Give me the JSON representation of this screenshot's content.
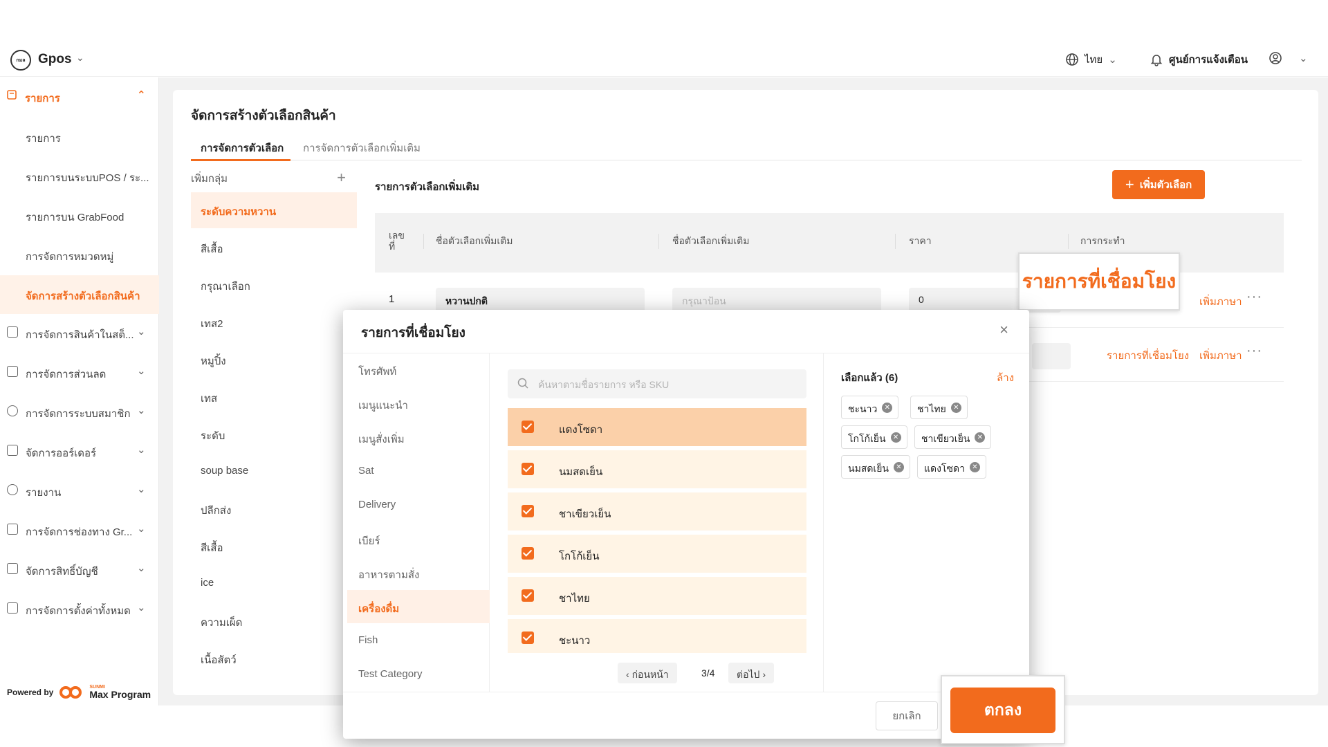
{
  "topbar": {
    "brand": "Gpos",
    "logo_text": "กมล",
    "language": "ไทย",
    "notifications": "ศูนย์การแจ้งเตือน"
  },
  "sidebar": {
    "section": "รายการ",
    "items": [
      {
        "label": "รายการ"
      },
      {
        "label": "รายการบนระบบPOS / ระ..."
      },
      {
        "label": "รายการบน GrabFood"
      },
      {
        "label": "การจัดการหมวดหมู่"
      },
      {
        "label": "จัดการสร้างตัวเลือกสินค้า",
        "active": true
      }
    ],
    "groups": [
      {
        "label": "การจัดการสินค้าในสต็..."
      },
      {
        "label": "การจัดการส่วนลด"
      },
      {
        "label": "การจัดการระบบสมาชิก"
      },
      {
        "label": "จัดการออร์เดอร์"
      },
      {
        "label": "รายงาน"
      },
      {
        "label": "การจัดการช่องทาง Gr..."
      },
      {
        "label": "จัดการสิทธิ์บัญชี"
      },
      {
        "label": "การจัดการตั้งค่าทั้งหมด"
      }
    ],
    "powered_by": "Powered by",
    "powered_brand": "Max Program",
    "powered_sub": "SUNMI"
  },
  "main": {
    "title": "จัดการสร้างตัวเลือกสินค้า",
    "tabs": [
      {
        "label": "การจัดการตัวเลือก",
        "active": true
      },
      {
        "label": "การจัดการตัวเลือกเพิ่มเติม"
      }
    ],
    "groups_header": "เพิ่มกลุ่ม",
    "groups": [
      "ระดับความหวาน",
      "สีเสื้อ",
      "กรุณาเลือก",
      "เทส2",
      "หมูปิ้ง",
      "เทส",
      "ระดับ",
      "soup base",
      "ปลีกส่ง",
      "สีเสื้อ",
      "ice",
      "ความเผ็ด",
      "เนื้อสัตว์"
    ],
    "panel_title": "รายการตัวเลือกเพิ่มเติม",
    "add_button": "เพิ่มตัวเลือก",
    "columns": [
      "เลข ที่",
      "ชื่อตัวเลือกเพิ่มเติม",
      "ชื่อตัวเลือกเพิ่มเติม",
      "ราคา",
      "การกระทำ"
    ],
    "rows": [
      {
        "no": "1",
        "name": "หวานปกติ",
        "name2_placeholder": "กรุณาป้อน",
        "price": "0",
        "link_lang": "เพิ่มภาษา"
      },
      {
        "link_linked": "รายการที่เชื่อมโยง",
        "link_lang": "เพิ่มภาษา"
      }
    ]
  },
  "callout_label": "รายการที่เชื่อมโยง",
  "modal": {
    "title": "รายการที่เชื่อมโยง",
    "categories": [
      "โทรศัพท์",
      "เมนูแนะนำ",
      "เมนูสั่งเพิ่ม",
      "Sat",
      "Delivery",
      "เบียร์",
      "อาหารตามสั่ง",
      "เครื่องดื่ม",
      "Fish",
      "Test Category"
    ],
    "active_category": "เครื่องดื่ม",
    "search_placeholder": "ค้นหาตามชื่อรายการ หรือ SKU",
    "items": [
      "แดงโซดา",
      "นมสดเย็น",
      "ชาเขียวเย็น",
      "โกโก้เย็น",
      "ชาไทย",
      "ชะนาว"
    ],
    "pager": {
      "prev": "ก่อนหน้า",
      "page": "3/4",
      "next": "ต่อไป"
    },
    "selected_header": "เลือกแล้ว (6)",
    "clear": "ล้าง",
    "chips": [
      "ชะนาว",
      "ชาไทย",
      "โกโก้เย็น",
      "ชาเขียวเย็น",
      "นมสดเย็น",
      "แดงโซดา"
    ],
    "cancel": "ยกเลิก",
    "ok": "ตกลง"
  },
  "colors": {
    "accent": "#f26b1d",
    "highlight": "#fbd0a9",
    "row_bg": "#fff4e5"
  }
}
